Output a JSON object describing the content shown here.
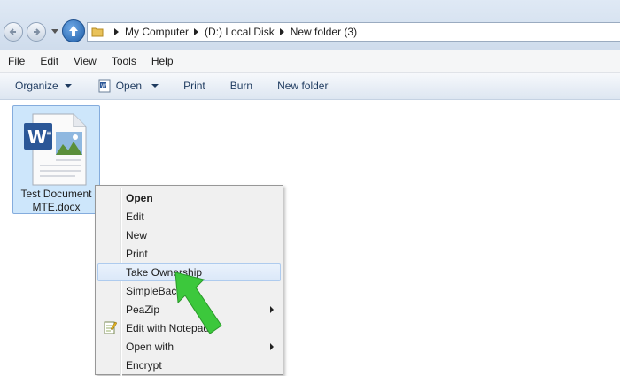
{
  "address_bar": {
    "crumbs": [
      "My Computer",
      "(D:) Local Disk",
      "New folder (3)"
    ]
  },
  "menubar": {
    "items": [
      "File",
      "Edit",
      "View",
      "Tools",
      "Help"
    ]
  },
  "toolbar": {
    "organize": "Organize",
    "open": "Open",
    "print": "Print",
    "burn": "Burn",
    "new_folder": "New folder"
  },
  "file": {
    "name_line1": "Test Document",
    "name_line2": "MTE.docx"
  },
  "context_menu": {
    "items": [
      {
        "label": "Open"
      },
      {
        "label": "Edit"
      },
      {
        "label": "New"
      },
      {
        "label": "Print"
      },
      {
        "label": "Take Ownership"
      },
      {
        "label": "SimpleBack"
      },
      {
        "label": "PeaZip"
      },
      {
        "label": "Edit with Notepad+"
      },
      {
        "label": "Open with"
      },
      {
        "label": "Encrypt"
      }
    ]
  },
  "icons": {
    "back": "back-arrow-icon",
    "forward": "forward-arrow-icon",
    "up": "up-arrow-icon",
    "folder": "folder-icon",
    "word_doc": "word-document-icon",
    "notepad": "notepad-plus-icon",
    "annotation": "green-arrow-icon"
  },
  "colors": {
    "selection": "#cde6fb",
    "menu_highlight": "#dbe8f8",
    "arrow": "#3cc83c"
  }
}
